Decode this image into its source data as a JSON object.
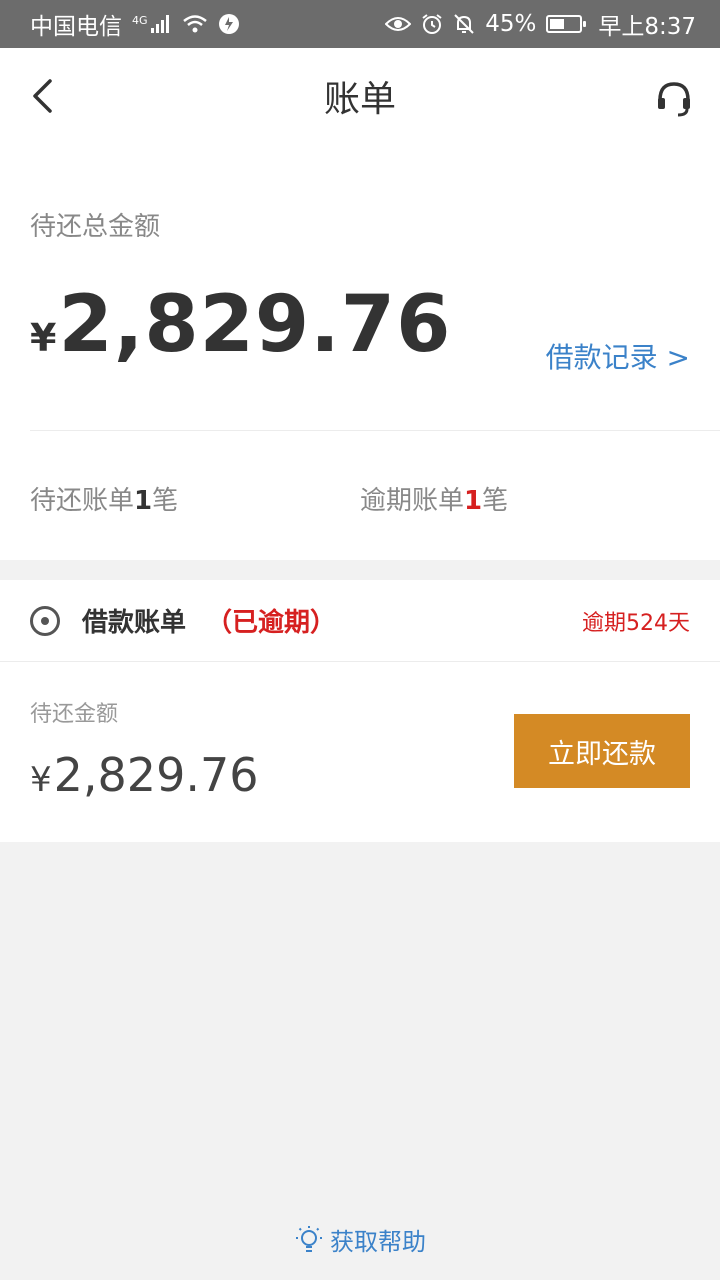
{
  "status_bar": {
    "carrier": "中国电信",
    "network": "4G",
    "battery": "45%",
    "battery_level": 0.45,
    "time": "早上8:37"
  },
  "header": {
    "title": "账单"
  },
  "summary": {
    "label": "待还总金额",
    "currency": "¥",
    "total": "2,829.76",
    "records_link": "借款记录 >",
    "pending_prefix": "待还账单",
    "pending_count": "1",
    "pending_suffix": "笔",
    "overdue_prefix": "逾期账单",
    "overdue_count": "1",
    "overdue_suffix": "笔"
  },
  "bill": {
    "name": "借款账单",
    "state": "（已逾期）",
    "overdue_days": "逾期524天",
    "due_label": "待还金额",
    "currency": "¥",
    "due_amount": "2,829.76",
    "pay_button": "立即还款"
  },
  "help": {
    "label": "获取帮助"
  },
  "colors": {
    "accent_blue": "#3b82c9",
    "overdue_red": "#d62020",
    "pay_orange": "#d48a25"
  }
}
